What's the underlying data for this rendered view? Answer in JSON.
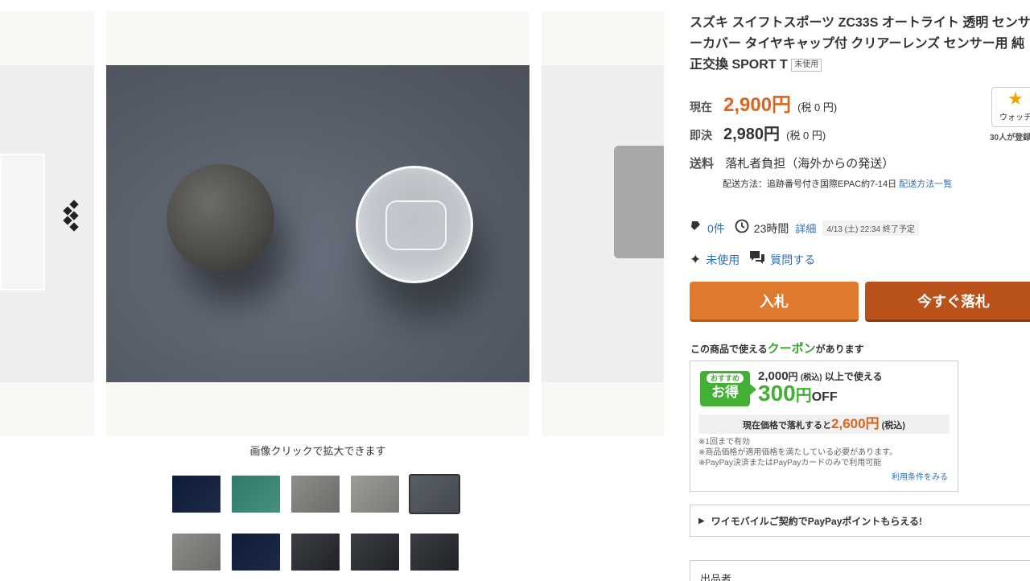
{
  "gallery": {
    "zoom_caption": "画像クリックで拡大できます",
    "prev_icon": "◆",
    "next_icon": "◆",
    "thumbnails": [
      {
        "label": "thumb-1",
        "active": false
      },
      {
        "label": "thumb-2",
        "active": false
      },
      {
        "label": "thumb-3",
        "active": false
      },
      {
        "label": "thumb-4",
        "active": false
      },
      {
        "label": "thumb-5",
        "active": true
      },
      {
        "label": "thumb-6",
        "active": false
      },
      {
        "label": "thumb-7",
        "active": false
      },
      {
        "label": "thumb-8",
        "active": false
      },
      {
        "label": "thumb-9",
        "active": false
      },
      {
        "label": "thumb-10",
        "active": false
      }
    ]
  },
  "product": {
    "title": "スズキ スイフトスポーツ ZC33S オートライト 透明 センサーカバー タイヤキャップ付 クリアーレンズ センサー用 純正交換 SPORT T",
    "condition_badge": "未使用"
  },
  "price": {
    "current_label": "現在",
    "current_value": "2,900円",
    "current_tax": "(税 0 円)",
    "buyout_label": "即決",
    "buyout_value": "2,980円",
    "buyout_tax": "(税 0 円)"
  },
  "watch": {
    "label": "ウォッチ",
    "count": "30人が登録"
  },
  "shipping": {
    "label": "送料",
    "value": "落札者負担（海外からの発送）",
    "method": "配送方法：追跡番号付き国際EPAC約7-14日",
    "method_link": "配送方法一覧"
  },
  "meta": {
    "bids": "0件",
    "time_left": "23時間",
    "detail_link": "詳細",
    "end_time": "4/13 (土) 22:34 終了予定",
    "condition": "未使用",
    "question": "質問する"
  },
  "buttons": {
    "bid": "入札",
    "buy_now": "今すぐ落札"
  },
  "coupon": {
    "head_prefix": "この商品で使える",
    "head_coupon": "クーポン",
    "head_suffix": "があります",
    "badge_small": "おすすめ",
    "badge_big": "お得",
    "min_amount": "2,000",
    "min_unit": "円",
    "min_tax": "(税込)",
    "min_suffix": "以上で使える",
    "discount": "300",
    "discount_unit": "円",
    "discount_off": "OFF",
    "net_prefix": "現在価格で落札すると",
    "net_price": "2,600円",
    "net_tax": "(税込)",
    "notes": [
      "※1回まで有効",
      "※商品価格が適用価格を満たしている必要があります。",
      "※PayPay決済またはPayPayカードのみで利用可能"
    ],
    "terms_link": "利用条件をみる"
  },
  "ymobile": {
    "text": "ワイモバイルご契約でPayPayポイントもらえる!"
  },
  "seller": {
    "label": "出品者"
  },
  "colors": {
    "accent_orange": "#d9651e",
    "bid_button": "#e07a2f",
    "buy_button": "#b9521b",
    "coupon_green": "#42b034",
    "link_blue": "#2e6fb7"
  }
}
